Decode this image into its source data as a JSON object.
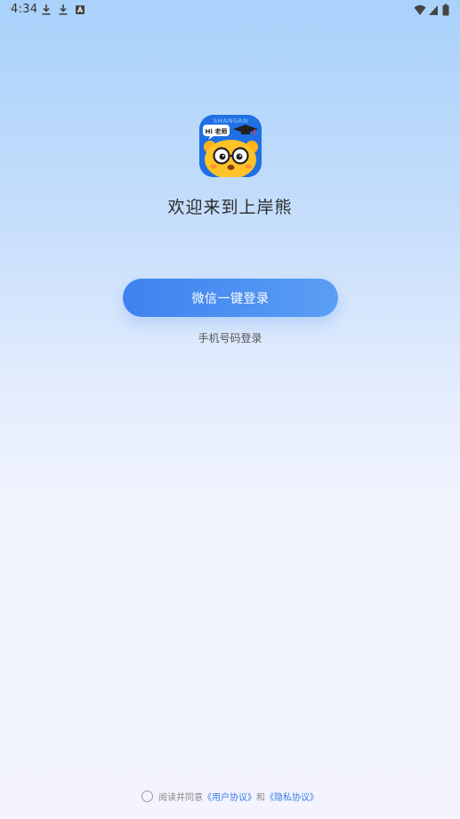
{
  "status_bar": {
    "time": "4:34",
    "left_icons": [
      "download-icon",
      "download-icon",
      "accessibility-a-icon"
    ],
    "right_icons": [
      "wifi-icon",
      "signal-icon",
      "battery-icon"
    ]
  },
  "logo": {
    "speech_bubble_text": "Hi 老师",
    "brand_text": "SHANGAN",
    "icon": "bear-mascot-logo-icon"
  },
  "welcome_text": "欢迎来到上岸熊",
  "wechat_login_label": "微信一键登录",
  "phone_login_label": "手机号码登录",
  "agreement": {
    "prefix": "阅读并同意",
    "user_agreement": "《用户协议》",
    "conjunction": "和",
    "privacy_policy": "《隐私协议》"
  },
  "colors": {
    "primary": "#3f82ef",
    "link": "#3a7be8"
  }
}
